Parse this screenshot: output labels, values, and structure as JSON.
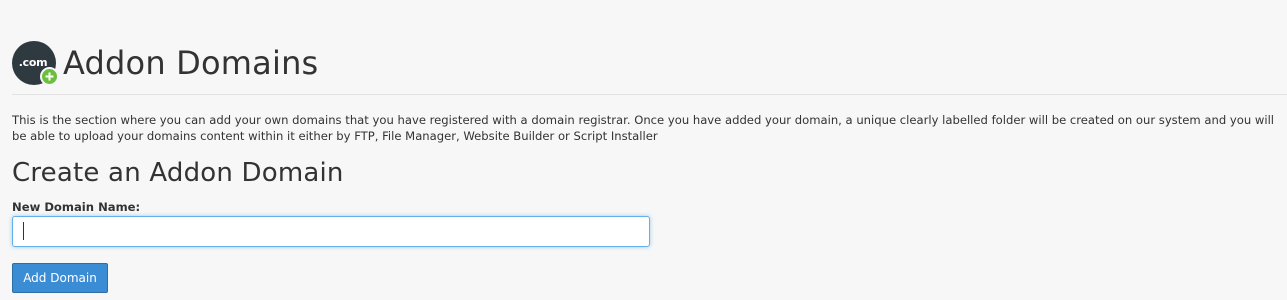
{
  "header": {
    "logo_text": ".com",
    "logo_icon": "domain-add-icon",
    "title": "Addon Domains"
  },
  "description": "This is the section where you can add your own domains that you have registered with a domain registrar. Once you have added your domain, a unique clearly labelled folder will be created on our system and you will be able to upload your domains content within it either by FTP, File Manager, Website Builder or Script Installer",
  "create_section": {
    "title": "Create an Addon Domain",
    "field_label": "New Domain Name:",
    "field_value": "",
    "button_label": "Add Domain"
  },
  "colors": {
    "background": "#f7f7f7",
    "logo_bg": "#2f3a40",
    "logo_plus": "#6cbf3c",
    "button_bg": "#3a8dd4",
    "input_focus_border": "#66afe9"
  }
}
